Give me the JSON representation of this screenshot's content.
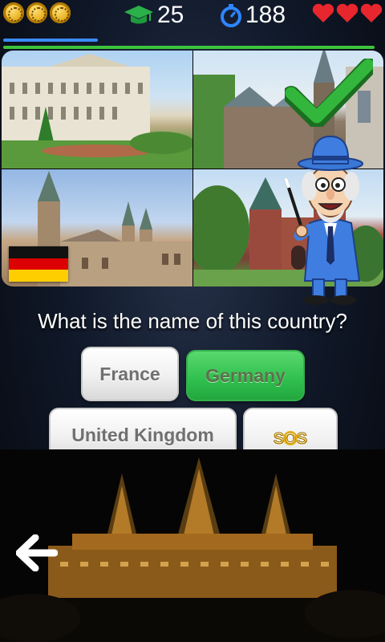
{
  "hud": {
    "coins": [
      {
        "icon": "coin-icon"
      },
      {
        "icon": "coin-icon"
      },
      {
        "icon": "coin-icon"
      }
    ],
    "score_icon": "graduation-cap-icon",
    "score": "25",
    "time_icon": "stopwatch-icon",
    "time": "188",
    "lives": [
      {
        "icon": "heart-icon"
      },
      {
        "icon": "heart-icon"
      },
      {
        "icon": "heart-icon"
      }
    ],
    "progress": {
      "time_fraction": 0.25,
      "level_fraction": 0.98
    }
  },
  "grid": {
    "images": [
      "palace-garden-photo",
      "cathedral-photo",
      "bamberg-cathedral-photo",
      "holsten-gate-photo"
    ],
    "flag_icon": "germany-flag-icon",
    "check_icon": "checkmark-icon"
  },
  "question": "What is the name of this country?",
  "answers": {
    "france": "France",
    "germany": "Germany",
    "uk": "United Kingdom",
    "sos": "SOS"
  },
  "colors": {
    "correct": "#2fbf4e",
    "heart": "#e8262d",
    "accent": "#3b8cff"
  }
}
